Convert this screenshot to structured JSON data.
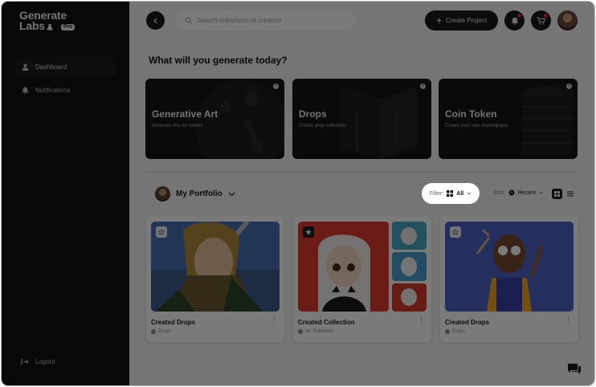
{
  "app": {
    "logo_line1": "Generate",
    "logo_line2": "Labs",
    "logo_badge": "Pro"
  },
  "sidebar": {
    "items": [
      {
        "label": "Dashboard",
        "icon": "user-icon",
        "active": true
      },
      {
        "label": "Notifications",
        "icon": "bell-icon",
        "active": false
      }
    ],
    "logout_label": "Logout"
  },
  "header": {
    "search_placeholder": "Search collections or creators",
    "create_label": "Create Project"
  },
  "main": {
    "heading": "What will you generate today?",
    "generate_cards": [
      {
        "title": "Generative Art",
        "subtitle": "Generate the Art tokens"
      },
      {
        "title": "Drops",
        "subtitle": "Create drop collection"
      },
      {
        "title": "Coin Token",
        "subtitle": "Create your own marketplace"
      }
    ],
    "portfolio_label": "My Portfolio",
    "filter_label": "Filter:",
    "filter_value": "All",
    "sort_label": "Sort:",
    "sort_value": "Recent",
    "items": [
      {
        "title": "Created Drops",
        "type": "Drops"
      },
      {
        "title": "Created Collection",
        "type": "Art Collection"
      },
      {
        "title": "Created Drops",
        "type": "Drops"
      }
    ]
  },
  "colors": {
    "sidebar_bg": "#111214",
    "accent_dark": "#1b1b1d",
    "notification_dot": "#e0352b"
  }
}
